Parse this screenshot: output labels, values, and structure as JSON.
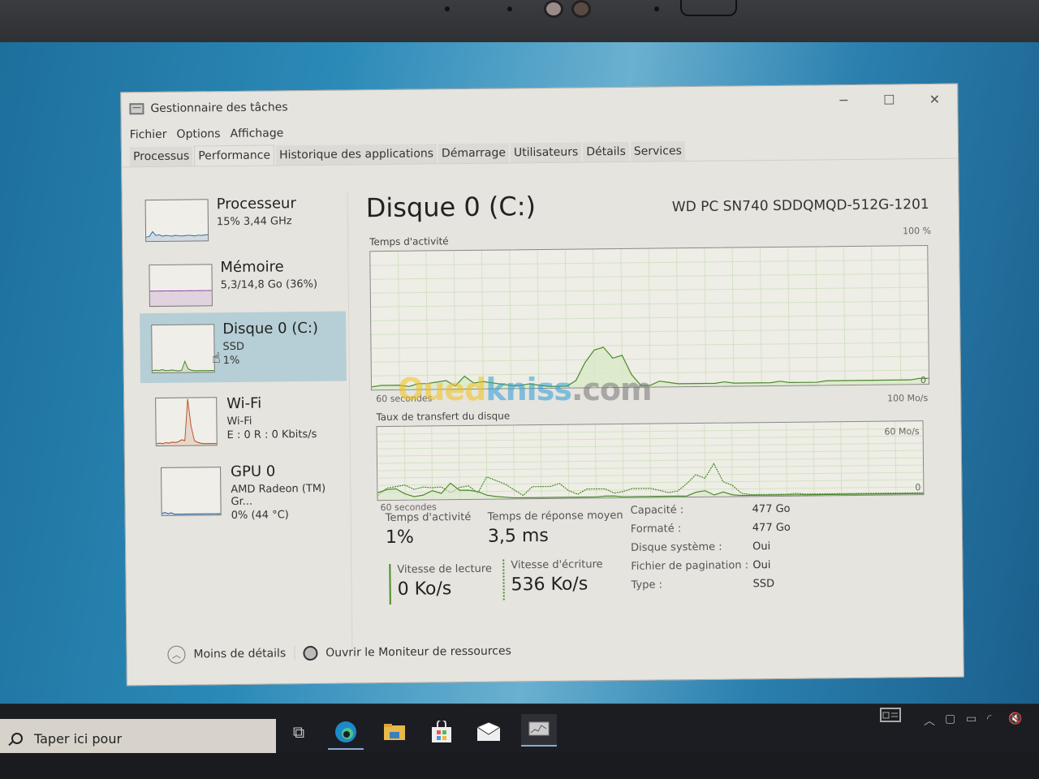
{
  "window": {
    "title": "Gestionnaire des tâches",
    "controls": {
      "minimize": "─",
      "maximize": "☐",
      "close": "✕"
    }
  },
  "menu": [
    "Fichier",
    "Options",
    "Affichage"
  ],
  "tabs": [
    {
      "label": "Processus",
      "active": false
    },
    {
      "label": "Performance",
      "active": true
    },
    {
      "label": "Historique des applications",
      "active": false
    },
    {
      "label": "Démarrage",
      "active": false
    },
    {
      "label": "Utilisateurs",
      "active": false
    },
    {
      "label": "Détails",
      "active": false
    },
    {
      "label": "Services",
      "active": false
    }
  ],
  "sidebar": {
    "items": [
      {
        "title": "Processeur",
        "sub": "15%  3,44 GHz",
        "sub2": "",
        "selected": false,
        "color": "#2b6cb0",
        "trace": [
          8,
          10,
          22,
          12,
          14,
          10,
          12,
          11,
          10,
          12,
          11,
          10,
          11,
          12,
          11,
          10,
          12,
          11,
          12,
          13
        ]
      },
      {
        "title": "Mémoire",
        "sub": "5,3/14,8 Go (36%)",
        "sub2": "",
        "selected": false,
        "color": "#8b3fa8",
        "trace": [
          36,
          36,
          36,
          36,
          36,
          36,
          36,
          36,
          36,
          36,
          36,
          36,
          36,
          36,
          36,
          36,
          36,
          36,
          36,
          36
        ]
      },
      {
        "title": "Disque 0 (C:)",
        "sub": "SSD",
        "sub2": "1%",
        "selected": true,
        "color": "#4b8a2b",
        "trace": [
          2,
          3,
          2,
          4,
          2,
          2,
          3,
          2,
          1,
          2,
          22,
          5,
          2,
          1,
          1,
          1,
          1,
          1,
          1,
          1
        ]
      },
      {
        "title": "Wi-Fi",
        "sub": "Wi-Fi",
        "sub2": "E : 0 R : 0 Kbits/s",
        "selected": false,
        "color": "#b5522a",
        "trace": [
          2,
          3,
          2,
          4,
          3,
          5,
          4,
          6,
          10,
          8,
          100,
          40,
          8,
          4,
          2,
          1,
          1,
          1,
          1,
          1
        ]
      },
      {
        "title": "GPU 0",
        "sub": "AMD Radeon (TM) Gr...",
        "sub2": "0% (44 °C)",
        "selected": false,
        "color": "#2b6cb0",
        "trace": [
          2,
          4,
          1,
          3,
          0,
          0,
          0,
          0,
          0,
          0,
          0,
          0,
          0,
          0,
          0,
          0,
          0,
          0,
          0,
          0
        ]
      }
    ]
  },
  "main": {
    "title": "Disque 0 (C:)",
    "model": "WD PC SN740 SDDQMQD-512G-1201",
    "activity_label": "Temps d'activité",
    "activity_max": "100 %",
    "activity_min": "0",
    "activity_time": "60 secondes",
    "transfer_label": "Taux de transfert du disque",
    "transfer_max": "100 Mo/s",
    "transfer_mid": "60 Mo/s",
    "transfer_min": "0",
    "transfer_time": "60 secondes"
  },
  "chart_data": [
    {
      "type": "area",
      "title": "Temps d'activité",
      "xlabel": "60 secondes",
      "ylabel": "",
      "ylim": [
        0,
        100
      ],
      "grid": true,
      "x": [
        0,
        1,
        2,
        3,
        4,
        5,
        6,
        7,
        8,
        9,
        10,
        11,
        12,
        13,
        14,
        15,
        16,
        17,
        18,
        19,
        20,
        21,
        22,
        23,
        24,
        25,
        26,
        27,
        28,
        29,
        30,
        31,
        32,
        33,
        34,
        35,
        36,
        37,
        38,
        39,
        40,
        41,
        42,
        43,
        44,
        45,
        46,
        47,
        48,
        49,
        50,
        51,
        52,
        53,
        54,
        55,
        56,
        57,
        58,
        59,
        60
      ],
      "series": [
        {
          "name": "Temps d'activité",
          "values": [
            2,
            3,
            3,
            3,
            2,
            4,
            4,
            5,
            6,
            2,
            9,
            4,
            5,
            4,
            3,
            2,
            2,
            3,
            2,
            1,
            1,
            1,
            5,
            18,
            27,
            29,
            21,
            23,
            9,
            1,
            1,
            4,
            3,
            2,
            2,
            2,
            2,
            2,
            3,
            2,
            2,
            2,
            2,
            2,
            3,
            2,
            2,
            2,
            2,
            3,
            3,
            3,
            3,
            3,
            3,
            3,
            3,
            3,
            3,
            4,
            4
          ]
        }
      ]
    },
    {
      "type": "line",
      "title": "Taux de transfert du disque",
      "xlabel": "60 secondes",
      "ylabel": "",
      "ylim": [
        0,
        100
      ],
      "grid": true,
      "x": [
        0,
        1,
        2,
        3,
        4,
        5,
        6,
        7,
        8,
        9,
        10,
        11,
        12,
        13,
        14,
        15,
        16,
        17,
        18,
        19,
        20,
        21,
        22,
        23,
        24,
        25,
        26,
        27,
        28,
        29,
        30,
        31,
        32,
        33,
        34,
        35,
        36,
        37,
        38,
        39,
        40,
        41,
        42,
        43,
        44,
        45,
        46,
        47,
        48,
        49,
        50,
        51,
        52,
        53,
        54,
        55,
        56,
        57,
        58,
        59,
        60
      ],
      "series": [
        {
          "name": "Vitesse de lecture",
          "values": [
            6,
            16,
            18,
            20,
            14,
            17,
            16,
            17,
            9,
            16,
            18,
            8,
            30,
            25,
            20,
            12,
            4,
            16,
            16,
            16,
            20,
            10,
            5,
            12,
            12,
            12,
            6,
            8,
            12,
            12,
            12,
            9,
            6,
            8,
            18,
            30,
            25,
            45,
            20,
            15,
            4,
            2,
            2,
            2,
            2,
            2,
            3,
            2,
            2,
            2,
            2,
            2,
            2,
            2,
            2,
            2,
            2,
            2,
            2,
            2,
            2
          ]
        },
        {
          "name": "Vitesse d'écriture",
          "values": [
            10,
            14,
            15,
            8,
            4,
            6,
            12,
            8,
            22,
            12,
            12,
            10,
            5,
            3,
            2,
            1,
            1,
            1,
            1,
            1,
            1,
            1,
            1,
            1,
            1,
            2,
            2,
            1,
            1,
            1,
            1,
            1,
            1,
            1,
            1,
            6,
            8,
            2,
            6,
            2,
            1,
            1,
            1,
            1,
            1,
            1,
            1,
            1,
            1,
            1,
            1,
            1,
            1,
            1,
            1,
            1,
            1,
            1,
            1,
            1,
            1
          ]
        }
      ]
    }
  ],
  "stats": {
    "activity_label": "Temps d'activité",
    "activity_value": "1%",
    "response_label": "Temps de réponse moyen",
    "response_value": "3,5 ms",
    "read_label": "Vitesse de lecture",
    "read_value": "0 Ko/s",
    "write_label": "Vitesse d'écriture",
    "write_value": "536 Ko/s"
  },
  "properties": [
    {
      "key": "Capacité :",
      "value": "477 Go"
    },
    {
      "key": "Formaté :",
      "value": "477 Go"
    },
    {
      "key": "Disque système :",
      "value": "Oui"
    },
    {
      "key": "Fichier de pagination :",
      "value": "Oui"
    },
    {
      "key": "Type :",
      "value": "SSD"
    }
  ],
  "footer": {
    "less_details": "Moins de détails",
    "resource_monitor": "Ouvrir le Moniteur de ressources"
  },
  "taskbar": {
    "search_placeholder": "Taper ici pour",
    "icons": [
      "task-view-icon",
      "edge-icon",
      "file-explorer-icon",
      "store-icon",
      "mail-icon",
      "task-manager-icon"
    ],
    "tray": [
      "news-icon",
      "chevron-up-icon",
      "meet-icon",
      "battery-icon",
      "wifi-icon",
      "volume-muted-icon"
    ]
  },
  "watermark": {
    "part1": "Oued",
    "part2": "kniss",
    "part3": ".com"
  },
  "colors": {
    "disk_accent": "#4b8a2b",
    "disk_fill": "#d9e8c8",
    "selected_bg": "#b6cfd6"
  }
}
